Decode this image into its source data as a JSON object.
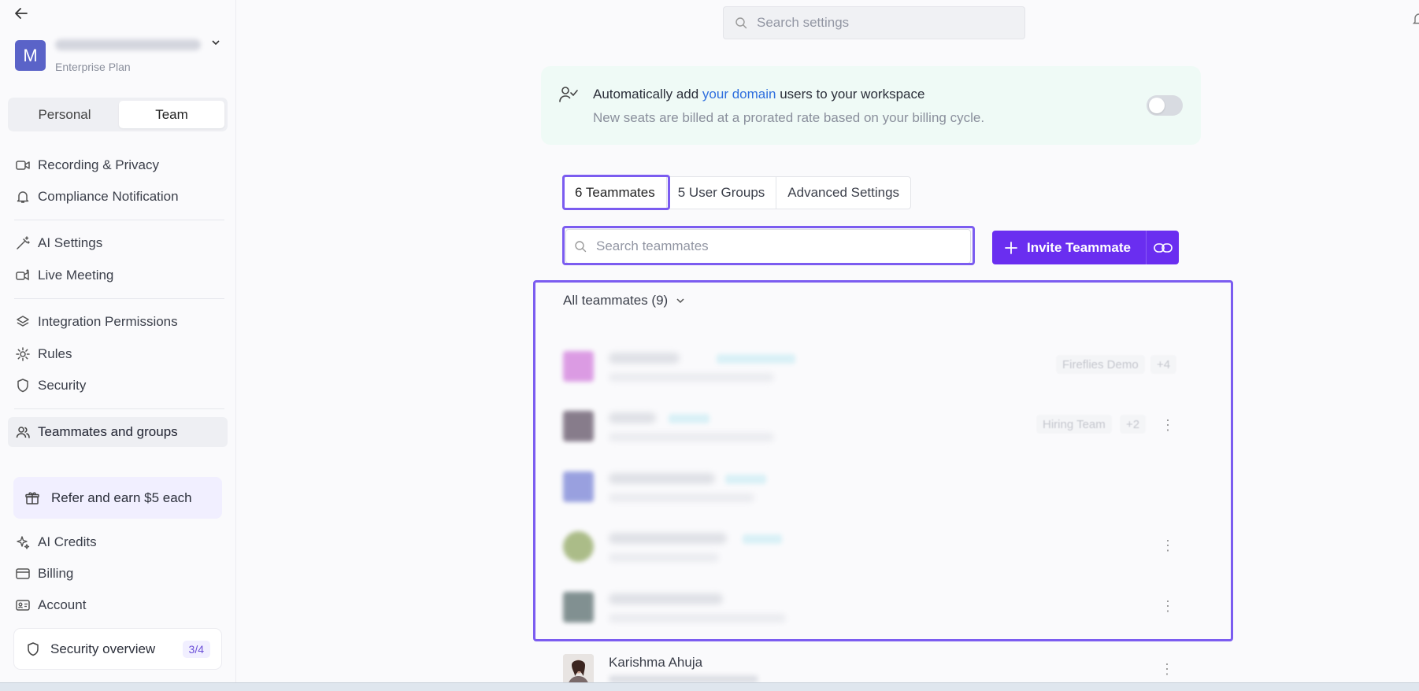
{
  "sidebar": {
    "account": {
      "initial": "M",
      "plan": "Enterprise Plan"
    },
    "segments": {
      "personal": "Personal",
      "team": "Team"
    },
    "items": [
      {
        "label": "Recording & Privacy",
        "icon": "video-icon"
      },
      {
        "label": "Compliance Notification",
        "icon": "bell-icon"
      },
      {
        "label": "AI Settings",
        "icon": "magic-wand-icon"
      },
      {
        "label": "Live Meeting",
        "icon": "live-meeting-icon"
      },
      {
        "label": "Integration Permissions",
        "icon": "layers-icon"
      },
      {
        "label": "Rules",
        "icon": "gear-icon"
      },
      {
        "label": "Security",
        "icon": "shield-icon"
      },
      {
        "label": "Teammates and groups",
        "icon": "users-icon",
        "active": true
      },
      {
        "label": "AI Credits",
        "icon": "sparkle-icon"
      },
      {
        "label": "Billing",
        "icon": "credit-card-icon"
      },
      {
        "label": "Account",
        "icon": "id-card-icon"
      }
    ],
    "refer": "Refer and earn $5 each",
    "security_overview": {
      "label": "Security overview",
      "badge": "3/4"
    }
  },
  "search": {
    "placeholder": "Search settings"
  },
  "banner": {
    "prefix": "Automatically add ",
    "link": "your domain",
    "suffix": " users to your workspace",
    "subtitle": "New seats are billed at a prorated rate based on your billing cycle.",
    "toggle_on": false
  },
  "tabs": [
    {
      "label": "6 Teammates",
      "active": true
    },
    {
      "label": "5 User Groups"
    },
    {
      "label": "Advanced Settings"
    }
  ],
  "teammate_search": {
    "placeholder": "Search teammates"
  },
  "invite_button": "Invite Teammate",
  "list": {
    "header": "All teammates (9)",
    "rows": [
      {
        "tags": [
          "Fireflies Demo",
          "+4"
        ]
      },
      {
        "tags": [
          "Hiring Team",
          "+2"
        ]
      },
      {
        "tags": []
      },
      {
        "tags": []
      },
      {
        "tags": []
      }
    ],
    "last_row_name": "Karishma Ahuja"
  },
  "colors": {
    "accent": "#6a2ef0",
    "highlight": "#7b5cf0",
    "link": "#2f6fde"
  }
}
